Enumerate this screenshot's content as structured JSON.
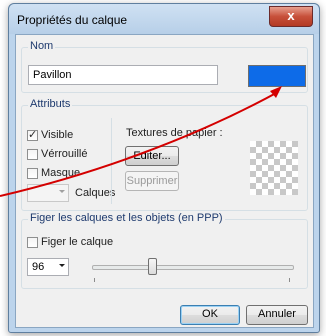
{
  "window": {
    "title": "Propriétés du calque",
    "close_label": "x"
  },
  "name_group": {
    "label": "Nom",
    "value": "Pavillon",
    "color": "#0d6be8"
  },
  "attributes_group": {
    "label": "Attributs",
    "visible_label": "Visible",
    "visible_checked": true,
    "locked_label": "Vérrouillé",
    "locked_checked": false,
    "mask_label": "Masque",
    "mask_checked": false,
    "layers_label": "Calques"
  },
  "paper_textures": {
    "label": "Textures de papier :",
    "edit_label": "Editer...",
    "delete_label": "Supprimer"
  },
  "freeze_group": {
    "label": "Figer les calques et les objets (en PPP)",
    "freeze_label": "Figer le calque",
    "freeze_checked": false,
    "ppp_value": "96",
    "slider_level": 0.3
  },
  "buttons": {
    "ok": "OK",
    "cancel": "Annuler"
  },
  "annotation": {
    "arrow_color": "#d40000"
  }
}
